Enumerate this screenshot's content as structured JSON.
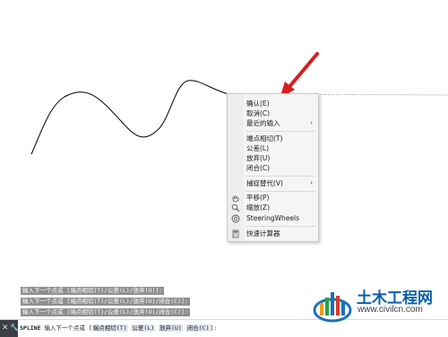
{
  "context_menu": {
    "items": [
      {
        "label": "确认(E)"
      },
      {
        "label": "取消(C)"
      },
      {
        "label": "最近的输入",
        "submenu": true
      },
      {
        "label": "端点相切(T)"
      },
      {
        "label": "公差(L)"
      },
      {
        "label": "放弃(U)"
      },
      {
        "label": "闭合(C)"
      },
      {
        "label": "捕捉替代(V)",
        "submenu": true
      },
      {
        "label": "平移(P)",
        "icon": "pan-icon"
      },
      {
        "label": "缩放(Z)",
        "icon": "zoom-icon"
      },
      {
        "label": "SteeringWheels",
        "icon": "steeringwheels-icon"
      },
      {
        "label": "快速计算器",
        "icon": "calculator-icon"
      }
    ],
    "submenu_arrow": "›"
  },
  "command_history": [
    "输入下一个点或 [端点相切(T)/公差(L)/放弃(U)]:",
    "输入下一个点或 [端点相切(T)/公差(L)/放弃(U)/闭合(C)]:",
    "输入下一个点或 [端点相切(T)/公差(L)/放弃(U)/闭合(C)]:"
  ],
  "command_line": {
    "command": "SPLINE",
    "prompt": "输入下一个点或",
    "open_bracket": "[",
    "options": [
      "端点相切(T)",
      "公差(L)",
      "放弃(U)",
      "闭合(C)"
    ],
    "close_bracket": "]:",
    "close_icon": "close-icon",
    "customize_icon": "wrench-icon"
  },
  "watermark": {
    "title": "土木工程网",
    "url": "www.civilcn.com",
    "logo_icon": "civilcn-logo-icon"
  },
  "colors": {
    "arrow": "#d81e1e",
    "spline": "#000000",
    "menu_bg": "#f5f5f5",
    "history_bg": "#8f8f8f",
    "brand": "#0b5ea8"
  }
}
